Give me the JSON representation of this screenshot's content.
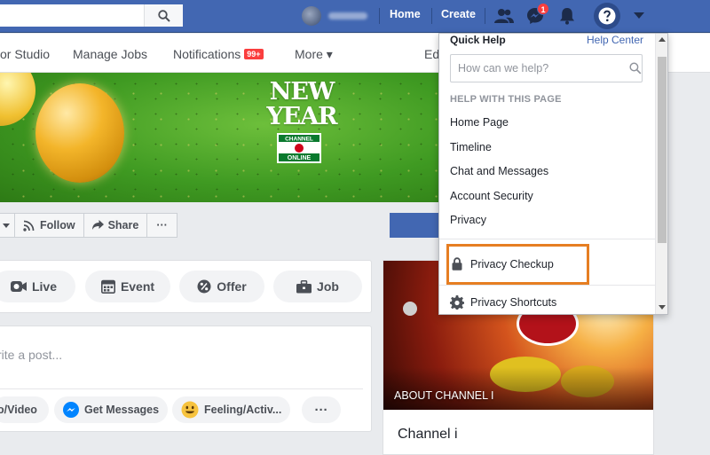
{
  "topbar": {
    "home_label": "Home",
    "create_label": "Create",
    "messages_badge": "1",
    "search_placeholder": ""
  },
  "subnav": {
    "items": [
      {
        "label": "or Studio"
      },
      {
        "label": "Manage Jobs"
      },
      {
        "label": "Notifications",
        "badge": "99+"
      },
      {
        "label": "More ▾"
      },
      {
        "label": "Ed"
      }
    ]
  },
  "cover": {
    "title_line1": "NEW",
    "title_line2": "YEAR",
    "logo_top": "CHANNEL",
    "logo_bottom": "ONLINE"
  },
  "page_actions": {
    "follow_label": "Follow",
    "share_label": "Share",
    "more_label": "···"
  },
  "composer": {
    "live_label": "Live",
    "event_label": "Event",
    "offer_label": "Offer",
    "job_label": "Job",
    "post_placeholder": "rite a post...",
    "photo_video_label": "o/Video",
    "get_messages_label": "Get Messages",
    "feeling_label": "Feeling/Activ...",
    "more_label": "···"
  },
  "side_card": {
    "caption": "ABOUT CHANNEL I",
    "title": "Channel i"
  },
  "help_menu": {
    "quick_help": "Quick Help",
    "help_center": "Help Center",
    "search_placeholder": "How can we help?",
    "section_title": "HELP WITH THIS PAGE",
    "items": [
      "Home Page",
      "Timeline",
      "Chat and Messages",
      "Account Security",
      "Privacy"
    ],
    "privacy_checkup": "Privacy Checkup",
    "privacy_shortcuts": "Privacy Shortcuts"
  },
  "colors": {
    "brand_blue": "#4267b2",
    "highlight_orange": "#e67e22",
    "badge_red": "#fa3e3e"
  }
}
